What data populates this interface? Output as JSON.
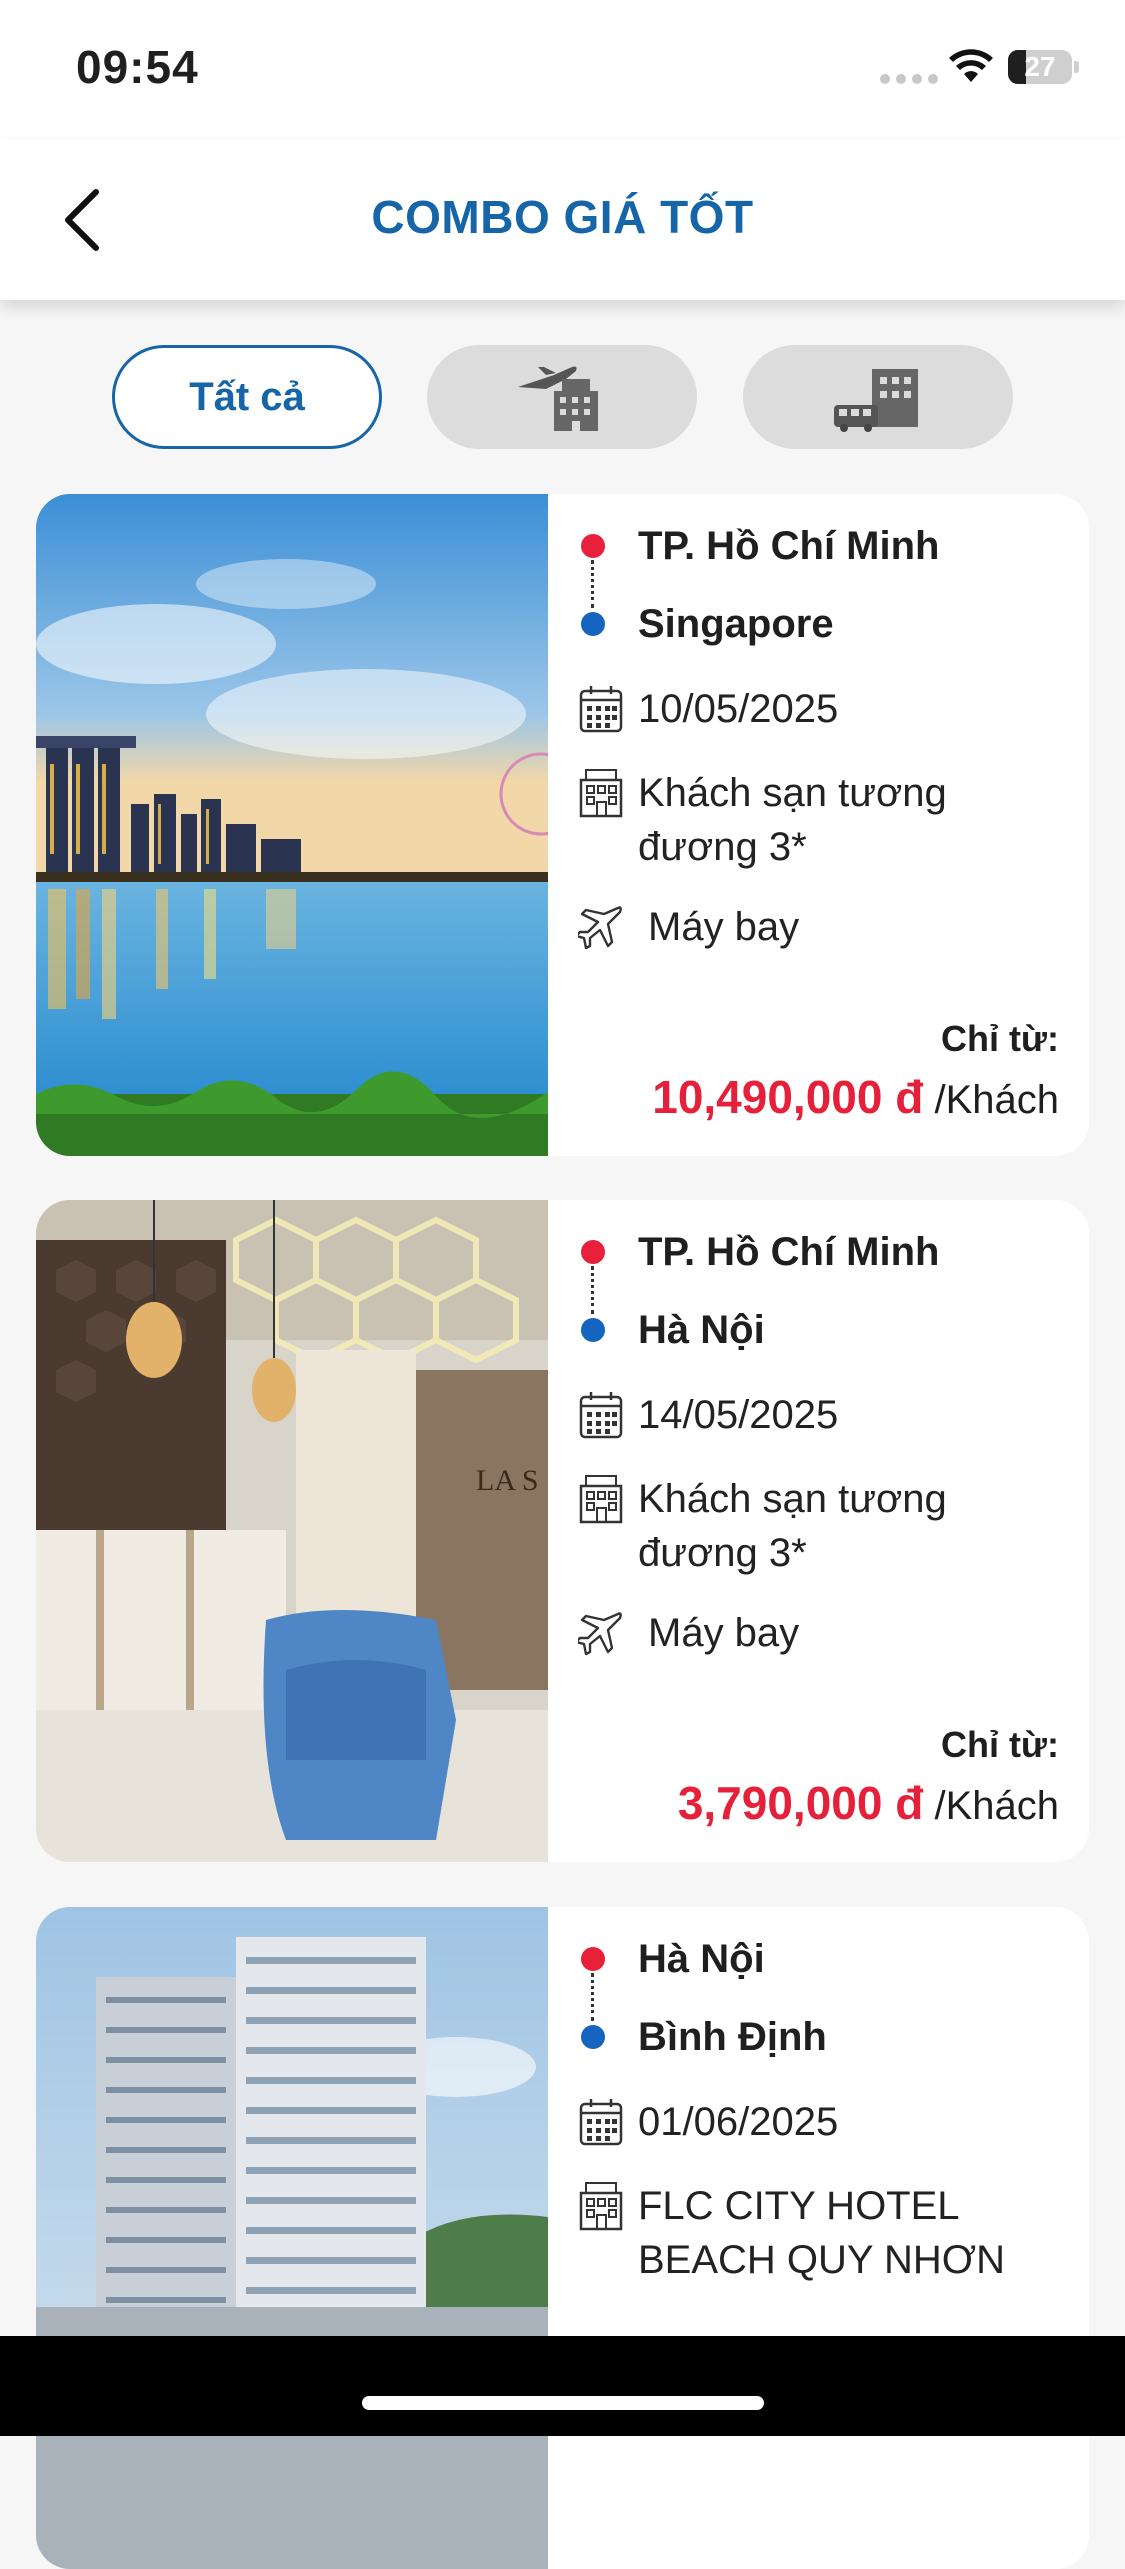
{
  "status_bar": {
    "time": "09:54",
    "battery": "27"
  },
  "header": {
    "title": "COMBO GIÁ TỐT"
  },
  "filters": [
    {
      "label": "Tất cả",
      "active": true
    },
    {
      "icon": "plane-hotel-icon",
      "active": false
    },
    {
      "icon": "bus-hotel-icon",
      "active": false
    }
  ],
  "combos": [
    {
      "from": "TP. Hồ Chí Minh",
      "to": "Singapore",
      "date": "10/05/2025",
      "hotel_line1": "Khách sạn tương",
      "hotel_line2": "đương 3*",
      "transport": "Máy bay",
      "price_label": "Chỉ từ:",
      "price": "10,490,000 đ",
      "price_unit": "/Khách"
    },
    {
      "from": "TP. Hồ Chí Minh",
      "to": "Hà Nội",
      "date": "14/05/2025",
      "hotel_line1": "Khách sạn tương",
      "hotel_line2": "đương 3*",
      "transport": "Máy bay",
      "price_label": "Chỉ từ:",
      "price": "3,790,000 đ",
      "price_unit": "/Khách"
    },
    {
      "from": "Hà Nội",
      "to": "Bình Định",
      "date": "01/06/2025",
      "hotel_line1": "FLC CITY HOTEL",
      "hotel_line2": "BEACH QUY NHƠN"
    }
  ],
  "colors": {
    "brand": "#1565a8",
    "price": "#e5203a",
    "dot_from": "#e8203a",
    "dot_to": "#1565c0"
  }
}
